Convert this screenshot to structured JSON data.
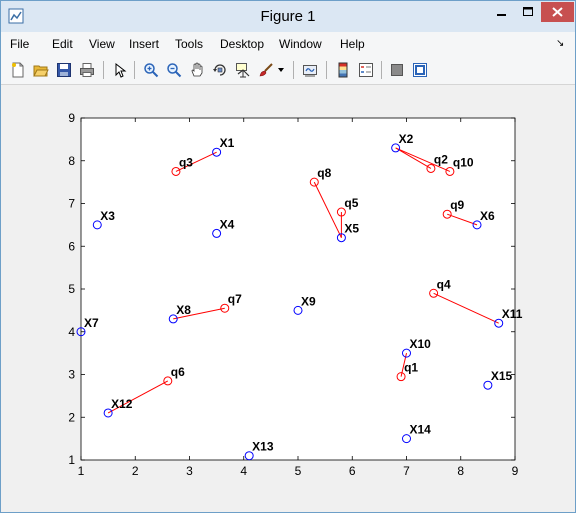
{
  "window": {
    "title": "Figure 1"
  },
  "menu": {
    "items": [
      "File",
      "Edit",
      "View",
      "Insert",
      "Tools",
      "Desktop",
      "Window",
      "Help"
    ]
  },
  "toolbar": {
    "buttons": [
      "new-figure-icon",
      "open-file-icon",
      "save-icon",
      "print-icon",
      "edit-plot-icon",
      "zoom-in-icon",
      "zoom-out-icon",
      "pan-icon",
      "rotate-3d-icon",
      "data-cursor-icon",
      "brush-icon",
      "brush-dropdown-icon",
      "link-plot-icon",
      "insert-colorbar-icon",
      "insert-legend-icon",
      "hide-plot-tools-icon",
      "show-plot-tools-icon"
    ]
  },
  "colors": {
    "blue_marker": "#0000ff",
    "red_marker": "#ff0000",
    "line": "#ff0000"
  },
  "chart_data": {
    "type": "scatter",
    "xlim": [
      1,
      9
    ],
    "ylim": [
      1,
      9
    ],
    "xticks": [
      "1",
      "2",
      "3",
      "4",
      "5",
      "6",
      "7",
      "8",
      "9"
    ],
    "yticks": [
      "1",
      "2",
      "3",
      "4",
      "5",
      "6",
      "7",
      "8",
      "9"
    ],
    "grid": false,
    "series": [
      {
        "marker": "blue-circle",
        "points": [
          {
            "label": "X1",
            "x": 3.5,
            "y": 8.2
          },
          {
            "label": "X2",
            "x": 6.8,
            "y": 8.3
          },
          {
            "label": "X3",
            "x": 1.3,
            "y": 6.5
          },
          {
            "label": "X4",
            "x": 3.5,
            "y": 6.3
          },
          {
            "label": "X5",
            "x": 5.8,
            "y": 6.2
          },
          {
            "label": "X6",
            "x": 8.3,
            "y": 6.5
          },
          {
            "label": "X7",
            "x": 1.0,
            "y": 4.0
          },
          {
            "label": "X8",
            "x": 2.7,
            "y": 4.3
          },
          {
            "label": "X9",
            "x": 5.0,
            "y": 4.5
          },
          {
            "label": "X10",
            "x": 7.0,
            "y": 3.5
          },
          {
            "label": "X11",
            "x": 8.7,
            "y": 4.2
          },
          {
            "label": "X12",
            "x": 1.5,
            "y": 2.1
          },
          {
            "label": "X13",
            "x": 4.1,
            "y": 1.1
          },
          {
            "label": "X14",
            "x": 7.0,
            "y": 1.5
          },
          {
            "label": "X15",
            "x": 8.5,
            "y": 2.75
          }
        ]
      },
      {
        "marker": "red-circle",
        "points": [
          {
            "label": "q1",
            "x": 6.9,
            "y": 2.95
          },
          {
            "label": "q2",
            "x": 7.45,
            "y": 7.82
          },
          {
            "label": "q3",
            "x": 2.75,
            "y": 7.75
          },
          {
            "label": "q4",
            "x": 7.5,
            "y": 4.9
          },
          {
            "label": "q5",
            "x": 5.8,
            "y": 6.8
          },
          {
            "label": "q6",
            "x": 2.6,
            "y": 2.85
          },
          {
            "label": "q7",
            "x": 3.65,
            "y": 4.55
          },
          {
            "label": "q8",
            "x": 5.3,
            "y": 7.5
          },
          {
            "label": "q9",
            "x": 7.75,
            "y": 6.75
          },
          {
            "label": "q10",
            "x": 7.8,
            "y": 7.75
          }
        ]
      }
    ],
    "segments": [
      {
        "from": "q1",
        "to": "X10"
      },
      {
        "from": "q2",
        "to": "X2"
      },
      {
        "from": "q10",
        "to": "X2"
      },
      {
        "from": "q3",
        "to": "X1"
      },
      {
        "from": "q4",
        "to": "X11"
      },
      {
        "from": "q5",
        "to": "X5"
      },
      {
        "from": "q8",
        "to": "X5"
      },
      {
        "from": "q6",
        "to": "X12"
      },
      {
        "from": "q7",
        "to": "X8"
      },
      {
        "from": "q9",
        "to": "X6"
      }
    ]
  }
}
